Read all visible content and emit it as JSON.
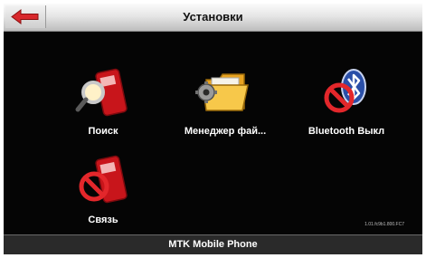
{
  "header": {
    "title": "Установки"
  },
  "items": [
    {
      "label": "Поиск"
    },
    {
      "label": "Менеджер фай..."
    },
    {
      "label": "Bluetooth Выкл"
    },
    {
      "label": "Связь"
    }
  ],
  "version": "1.01.fc9b1.800.FC7",
  "footer": {
    "device_name": "MTK Mobile Phone"
  },
  "colors": {
    "accent_red": "#e3272b",
    "background": "#050505"
  }
}
